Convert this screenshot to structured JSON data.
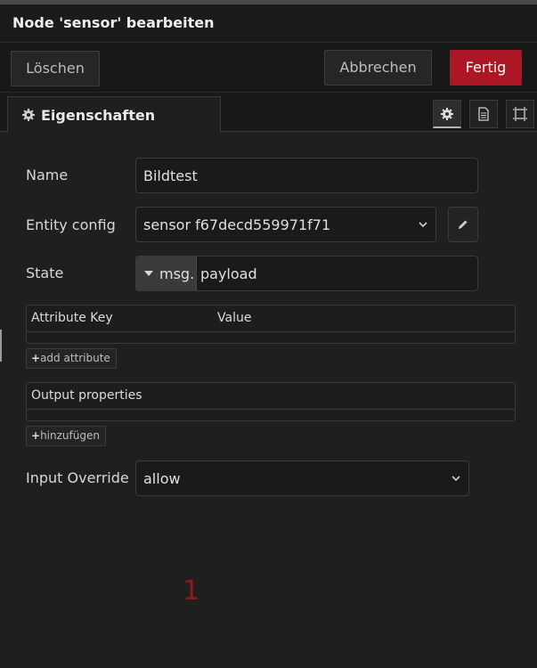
{
  "dialog": {
    "title": "Node 'sensor' bearbeiten"
  },
  "actions": {
    "delete_label": "Löschen",
    "cancel_label": "Abbrechen",
    "done_label": "Fertig",
    "done_color": "#ad1625"
  },
  "tabs": [
    {
      "label": "Eigenschaften",
      "icon": "gear-icon"
    }
  ],
  "tab_icons": [
    "gear-icon",
    "document-icon",
    "frame-icon"
  ],
  "form": {
    "name": {
      "label": "Name",
      "value": "Bildtest"
    },
    "entity_config": {
      "label": "Entity config",
      "value": "sensor f67decd559971f71"
    },
    "state": {
      "label": "State",
      "type_prefix": "msg.",
      "value": "payload"
    },
    "attributes": {
      "col_key": "Attribute Key",
      "col_value": "Value",
      "add_label": "add attribute"
    },
    "output": {
      "header": "Output properties",
      "add_label": "hinzufügen"
    },
    "input_override": {
      "label": "Input Override",
      "value": "allow"
    }
  },
  "annotation": {
    "text": "1",
    "color": "#8f1b1b"
  }
}
